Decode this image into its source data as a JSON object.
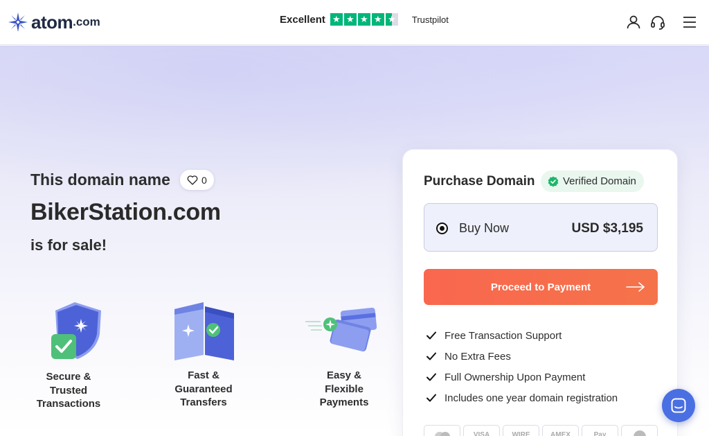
{
  "header": {
    "logo_text": "atom",
    "logo_suffix": ".com",
    "trust_word": "Excellent",
    "trust_rating_stars": 4.5,
    "trust_brand": "Trustpilot",
    "icons": [
      "user-icon",
      "headset-icon",
      "menu-icon"
    ]
  },
  "hero": {
    "intro": "This domain name",
    "favorites_count": "0",
    "domain": "BikerStation.com",
    "for_sale": "is for sale!"
  },
  "features": [
    {
      "label_lines": [
        "Secure &",
        "Trusted",
        "Transactions"
      ]
    },
    {
      "label_lines": [
        "Fast &",
        "Guaranteed",
        "Transfers"
      ]
    },
    {
      "label_lines": [
        "Easy &",
        "Flexible",
        "Payments"
      ]
    }
  ],
  "purchase": {
    "title": "Purchase Domain",
    "verified_label": "Verified Domain",
    "option_label": "Buy Now",
    "price": "USD $3,195",
    "proceed_label": "Proceed to Payment",
    "benefits": [
      "Free Transaction Support",
      "No Extra Fees",
      "Full Ownership Upon Payment",
      "Includes one year domain registration"
    ],
    "payment_logos": [
      "mastercard",
      "VISA",
      "WIRE",
      "AMEX",
      "Pay",
      "bitcoin"
    ]
  },
  "colors": {
    "accent_orange": "#f9674f",
    "trustpilot_green": "#00b67a",
    "verified_green": "#1db66a",
    "chat_blue": "#4a6fe3",
    "brand_navy": "#1f2a44"
  }
}
